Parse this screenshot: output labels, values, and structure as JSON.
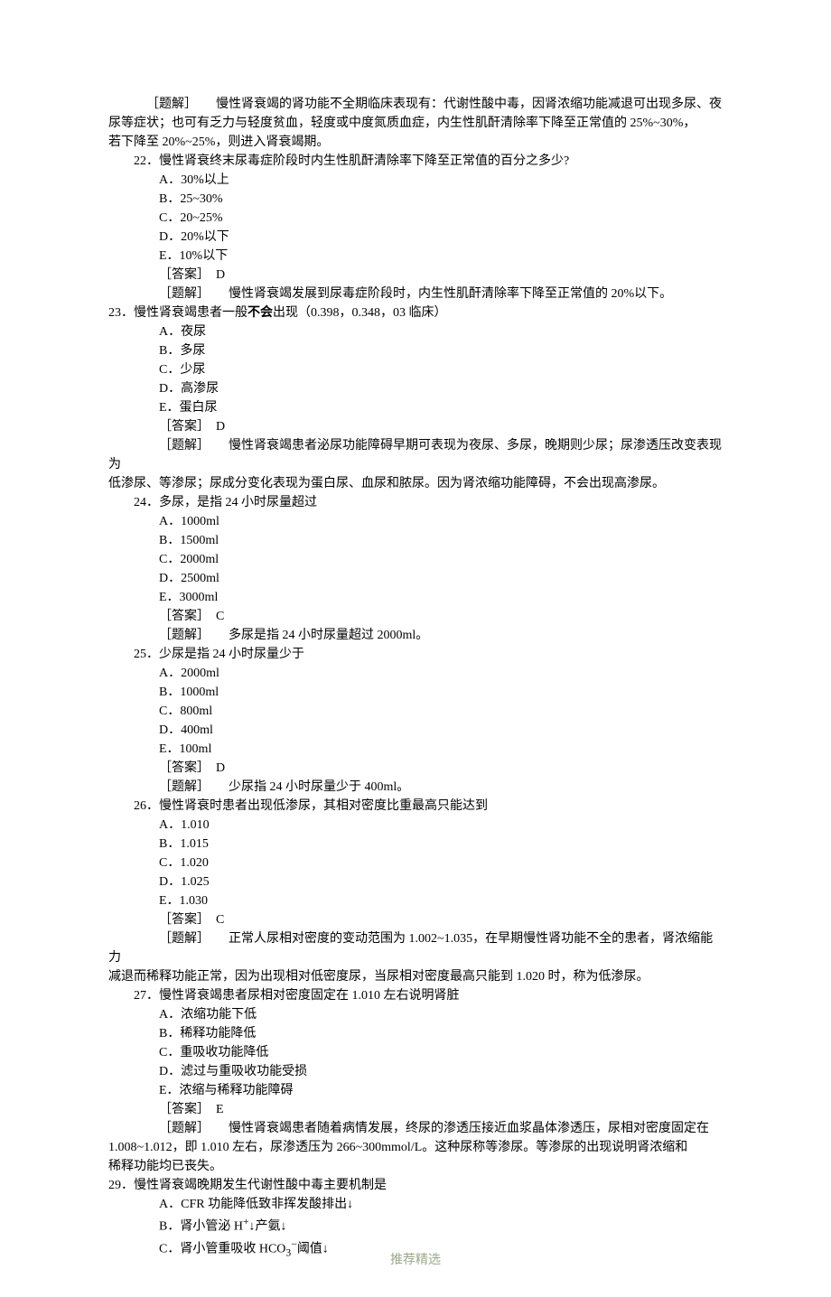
{
  "footer": "推荐精选",
  "content": [
    {
      "cls": "indent1",
      "text": "［题解］　　慢性肾衰竭的肾功能不全期临床表现有：代谢性酸中毒，因肾浓缩功能减退可出现多尿、夜"
    },
    {
      "cls": "flushleft",
      "text": "尿等症状；也可有乏力与轻度贫血，轻度或中度氮质血症，内生性肌酐清除率下降至正常值的 25%~30%，"
    },
    {
      "cls": "flushleft",
      "text": "若下降至 20%~25%，则进入肾衰竭期。"
    },
    {
      "cls": "qline",
      "text": "22．慢性肾衰终末尿毒症阶段时内生性肌酐清除率下降至正常值的百分之多少?"
    },
    {
      "cls": "opt",
      "text": "A．30%以上"
    },
    {
      "cls": "opt",
      "text": "B．25~30%"
    },
    {
      "cls": "opt",
      "text": "C．20~25%"
    },
    {
      "cls": "opt",
      "text": "D．20%以下"
    },
    {
      "cls": "opt",
      "text": "E．10%以下"
    },
    {
      "cls": "ans",
      "text": "［答案］　D"
    },
    {
      "cls": "exp",
      "text": "［题解］　　慢性肾衰竭发展到尿毒症阶段时，内生性肌酐清除率下降至正常值的 20%以下。"
    },
    {
      "cls": "flushleft",
      "html": "23．慢性肾衰竭患者一般<span class=\"bold\">不会</span>出现（0.398，0.348，03 临床）"
    },
    {
      "cls": "opt",
      "text": "A．夜尿"
    },
    {
      "cls": "opt",
      "text": "B．多尿"
    },
    {
      "cls": "opt",
      "text": "C．少尿"
    },
    {
      "cls": "opt",
      "text": "D．高渗尿"
    },
    {
      "cls": "opt",
      "text": "E．蛋白尿"
    },
    {
      "cls": "ans",
      "text": "［答案］　D"
    },
    {
      "cls": "exp",
      "text": "［题解］　　慢性肾衰竭患者泌尿功能障碍早期可表现为夜尿、多尿，晚期则少尿；尿渗透压改变表现为"
    },
    {
      "cls": "flushleft",
      "text": "低渗尿、等渗尿；尿成分变化表现为蛋白尿、血尿和脓尿。因为肾浓缩功能障碍，不会出现高渗尿。"
    },
    {
      "cls": "qline",
      "text": "24．多尿，是指 24 小时尿量超过"
    },
    {
      "cls": "opt",
      "text": "A．1000ml"
    },
    {
      "cls": "opt",
      "text": "B．1500ml"
    },
    {
      "cls": "opt",
      "text": "C．2000ml"
    },
    {
      "cls": "opt",
      "text": "D．2500ml"
    },
    {
      "cls": "opt",
      "text": "E．3000ml"
    },
    {
      "cls": "ans",
      "text": "［答案］　C"
    },
    {
      "cls": "exp",
      "text": "［题解］　　多尿是指 24 小时尿量超过 2000ml。"
    },
    {
      "cls": "qline",
      "text": "25．少尿是指 24 小时尿量少于"
    },
    {
      "cls": "opt",
      "text": "A．2000ml"
    },
    {
      "cls": "opt",
      "text": "B．1000ml"
    },
    {
      "cls": "opt",
      "text": "C．800ml"
    },
    {
      "cls": "opt",
      "text": "D．400ml"
    },
    {
      "cls": "opt",
      "text": "E．100ml"
    },
    {
      "cls": "ans",
      "text": "［答案］　D"
    },
    {
      "cls": "exp",
      "text": "［题解］　　少尿指 24 小时尿量少于 400ml。"
    },
    {
      "cls": "qline",
      "text": "26．慢性肾衰时患者出现低渗尿，其相对密度比重最高只能达到"
    },
    {
      "cls": "opt",
      "text": "A．1.010"
    },
    {
      "cls": "opt",
      "text": "B．1.015"
    },
    {
      "cls": "opt",
      "text": "C．1.020"
    },
    {
      "cls": "opt",
      "text": "D．1.025"
    },
    {
      "cls": "opt",
      "text": "E．1.030"
    },
    {
      "cls": "ans",
      "text": "［答案］　C"
    },
    {
      "cls": "exp",
      "text": "［题解］　　正常人尿相对密度的变动范围为 1.002~1.035，在早期慢性肾功能不全的患者，肾浓缩能力"
    },
    {
      "cls": "flushleft",
      "text": "减退而稀释功能正常，因为出现相对低密度尿，当尿相对密度最高只能到 1.020 时，称为低渗尿。"
    },
    {
      "cls": "qline",
      "text": "27．慢性肾衰竭患者尿相对密度固定在 1.010 左右说明肾脏"
    },
    {
      "cls": "opt",
      "text": "A．浓缩功能下低"
    },
    {
      "cls": "opt",
      "text": "B．稀释功能降低"
    },
    {
      "cls": "opt",
      "text": "C．重吸收功能降低"
    },
    {
      "cls": "opt",
      "text": "D．滤过与重吸收功能受损"
    },
    {
      "cls": "opt",
      "text": "E．浓缩与稀释功能障碍"
    },
    {
      "cls": "ans",
      "text": "［答案］　E"
    },
    {
      "cls": "exp",
      "text": "［题解］　　慢性肾衰竭患者随着病情发展，终尿的渗透压接近血浆晶体渗透压，尿相对密度固定在"
    },
    {
      "cls": "flushleft",
      "text": "1.008~1.012，即 1.010 左右，尿渗透压为 266~300mmol/L。这种尿称等渗尿。等渗尿的出现说明肾浓缩和"
    },
    {
      "cls": "flushleft",
      "text": "稀释功能均已丧失。"
    },
    {
      "cls": "flushleft",
      "text": "29．慢性肾衰竭晚期发生代谢性酸中毒主要机制是"
    },
    {
      "cls": "opt",
      "text": "A．CFR 功能降低致非挥发酸排出↓"
    },
    {
      "cls": "opt",
      "html": "B．肾小管泌 H<sup>+</sup>↓产氨↓"
    },
    {
      "cls": "opt",
      "html": "C．肾小管重吸收 HCO<sub>3</sub><sup>−</sup>阈值↓"
    }
  ]
}
